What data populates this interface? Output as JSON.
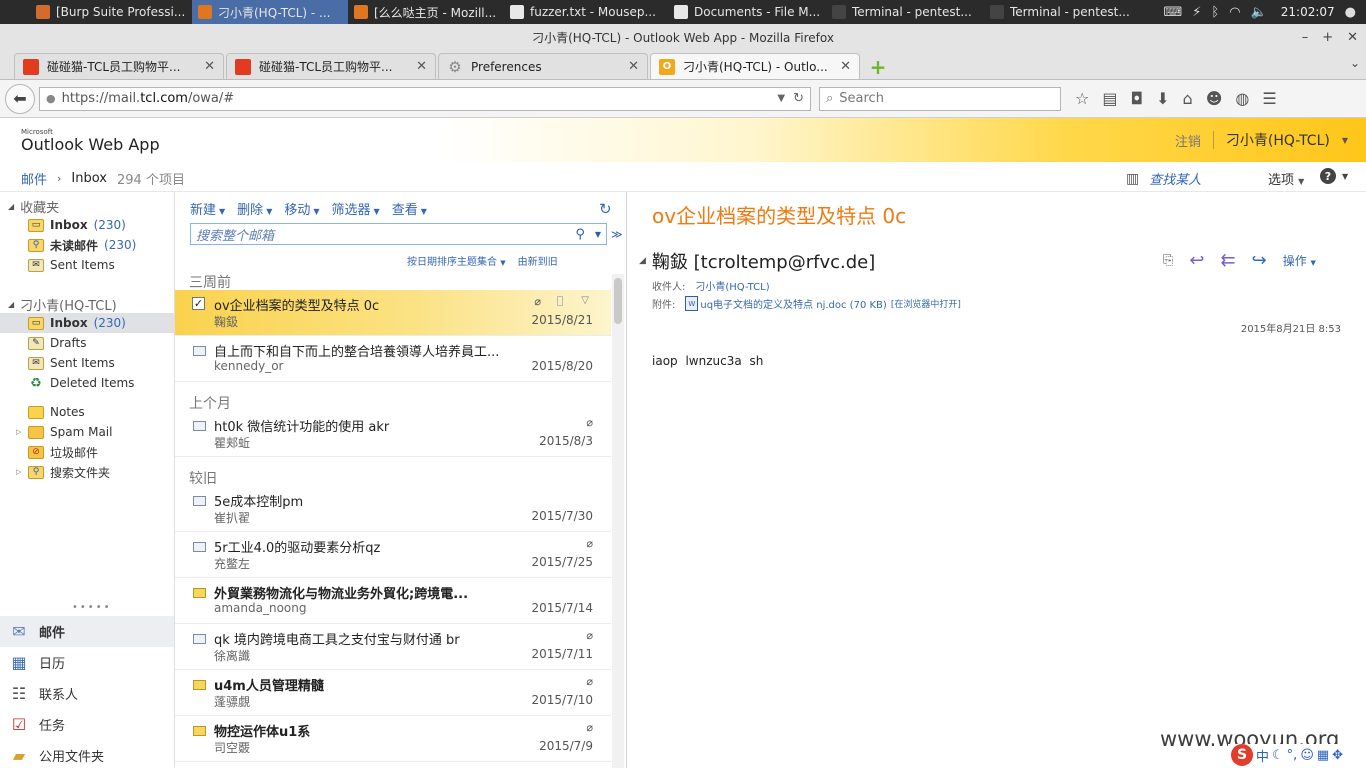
{
  "taskbar": {
    "tasks": [
      {
        "label": "[Burp Suite Professi...",
        "color": "#d36b2e",
        "active": false
      },
      {
        "label": "刁小青(HQ-TCL) - ...",
        "color": "#e0761d",
        "active": true
      },
      {
        "label": "[么么哒主页 - Mozill...",
        "color": "#e0761d",
        "active": false
      },
      {
        "label": "fuzzer.txt - Mousep...",
        "color": "#e8e8e8",
        "active": false
      },
      {
        "label": "Documents - File M...",
        "color": "#e8e8e8",
        "active": false
      },
      {
        "label": "Terminal - pentest...",
        "color": "#444444",
        "active": false
      },
      {
        "label": "Terminal - pentest...",
        "color": "#444444",
        "active": false
      }
    ],
    "clock": "21:02:07"
  },
  "window": {
    "title": "刁小青(HQ-TCL) - Outlook Web App - Mozilla Firefox"
  },
  "tabs": [
    {
      "title": "碰碰猫-TCL员工购物平...",
      "icon_color": "#e33b1f",
      "active": false
    },
    {
      "title": "碰碰猫-TCL员工购物平...",
      "icon_color": "#e33b1f",
      "active": false
    },
    {
      "title": "Preferences",
      "icon_color": "#8a8a8a",
      "active": false
    },
    {
      "title": "刁小青(HQ-TCL) - Outlo...",
      "icon_color": "#f2a81d",
      "active": true
    }
  ],
  "nav": {
    "url_prefix": "https://mail.",
    "url_host": "tcl.com",
    "url_path": "/owa/#",
    "search_placeholder": "Search"
  },
  "owa": {
    "logo_small": "Microsoft",
    "logo": "Outlook Web App",
    "signout": "注销",
    "user": "刁小青(HQ-TCL)",
    "breadcrumb": {
      "mail": "邮件",
      "folder": "Inbox",
      "count": "294 个项目"
    },
    "find_person": "查找某人",
    "options": "选项",
    "help": "?"
  },
  "leftnav": {
    "favorites_header": "收藏夹",
    "favorites": [
      {
        "label": "Inbox",
        "count": "(230)",
        "icon": "inbox-folder-icon",
        "bold": true
      },
      {
        "label": "未读邮件",
        "count": "(230)",
        "icon": "search-folder-icon",
        "bold": true
      },
      {
        "label": "Sent Items",
        "count": "",
        "icon": "sent-items-icon",
        "bold": false
      }
    ],
    "mailbox_header": "刁小青(HQ-TCL)",
    "folders": [
      {
        "label": "Inbox",
        "count": "(230)",
        "icon": "inbox-folder-icon",
        "bold": true,
        "selected": true,
        "expander": false
      },
      {
        "label": "Drafts",
        "count": "",
        "icon": "drafts-folder-icon",
        "bold": false,
        "selected": false,
        "expander": false
      },
      {
        "label": "Sent Items",
        "count": "",
        "icon": "sent-items-icon",
        "bold": false,
        "selected": false,
        "expander": false
      },
      {
        "label": "Deleted Items",
        "count": "",
        "icon": "deleted-items-icon",
        "bold": false,
        "selected": false,
        "expander": false
      },
      {
        "label": "Notes",
        "count": "",
        "icon": "notes-folder-icon",
        "bold": false,
        "selected": false,
        "expander": false
      },
      {
        "label": "Spam Mail",
        "count": "",
        "icon": "spam-folder-icon",
        "bold": false,
        "selected": false,
        "expander": true
      },
      {
        "label": "垃圾邮件",
        "count": "",
        "icon": "junk-folder-icon",
        "bold": false,
        "selected": false,
        "expander": false
      },
      {
        "label": "搜索文件夹",
        "count": "",
        "icon": "search-folder-icon",
        "bold": false,
        "selected": false,
        "expander": true
      }
    ],
    "modules": [
      {
        "label": "邮件",
        "icon": "mail-module-icon",
        "selected": true
      },
      {
        "label": "日历",
        "icon": "calendar-module-icon",
        "selected": false
      },
      {
        "label": "联系人",
        "icon": "contacts-module-icon",
        "selected": false
      },
      {
        "label": "任务",
        "icon": "tasks-module-icon",
        "selected": false
      },
      {
        "label": "公用文件夹",
        "icon": "public-folders-module-icon",
        "selected": false
      }
    ]
  },
  "msglist": {
    "toolbar": [
      "新建",
      "删除",
      "移动",
      "筛选器",
      "查看"
    ],
    "search_placeholder": "搜索整个邮箱",
    "sort_by": "按日期排序主题集合",
    "sort_order": "由新到旧",
    "groups": [
      {
        "label": "三周前",
        "messages": [
          {
            "subject": "ov企业档案的类型及特点 0c",
            "sender": "鞠鈒",
            "date": "2015/8/21",
            "attachment": true,
            "unread": false,
            "selected": true
          }
        ]
      },
      {
        "label": "",
        "messages": [
          {
            "subject": "自上而下和自下而上的整合培養領導人培养員工...",
            "sender": "kennedy_or",
            "date": "2015/8/20",
            "attachment": false,
            "unread": false,
            "selected": false
          }
        ]
      },
      {
        "label": "上个月",
        "messages": [
          {
            "subject": "ht0k 微信统计功能的使用 akr",
            "sender": "瞿郏蚯",
            "date": "2015/8/3",
            "attachment": true,
            "unread": false,
            "selected": false
          }
        ]
      },
      {
        "label": "较旧",
        "messages": [
          {
            "subject": "5e成本控制pm",
            "sender": "崔扒翟",
            "date": "2015/7/30",
            "attachment": false,
            "unread": false,
            "selected": false
          },
          {
            "subject": "5r工业4.0的驱动要素分析qz",
            "sender": "充鳖左",
            "date": "2015/7/25",
            "attachment": true,
            "unread": false,
            "selected": false
          },
          {
            "subject": "外貿業務物流化与物流业务外貿化;跨境電...",
            "sender": "amanda_noong",
            "date": "2015/7/14",
            "attachment": false,
            "unread": true,
            "selected": false
          },
          {
            "subject": "qk 境内跨境电商工具之支付宝与财付通 br",
            "sender": "徐离讖",
            "date": "2015/7/11",
            "attachment": true,
            "unread": false,
            "selected": false
          },
          {
            "subject": "u4m人员管理精髓",
            "sender": "蓬骠覷",
            "date": "2015/7/10",
            "attachment": true,
            "unread": true,
            "selected": false
          },
          {
            "subject": "物控运作体u1系",
            "sender": "司空覈",
            "date": "2015/7/9",
            "attachment": true,
            "unread": true,
            "selected": false
          }
        ]
      }
    ]
  },
  "reading": {
    "subject": "ov企业档案的类型及特点 0c",
    "from": "鞠鈒 [tcroltemp@rfvc.de]",
    "to_label": "收件人:",
    "to": "刁小青(HQ-TCL)",
    "attach_label": "附件:",
    "attachment": "uq电子文档的定义及特点 nj.doc (70 KB)",
    "open_in_browser": "[在浏览器中打开]",
    "actions_label": "操作",
    "date": "2015年8月21日 8:53",
    "body": "iaop lwnzuc3a sh"
  },
  "watermark": "www.wooyun.org",
  "ime": {
    "label": "中"
  }
}
